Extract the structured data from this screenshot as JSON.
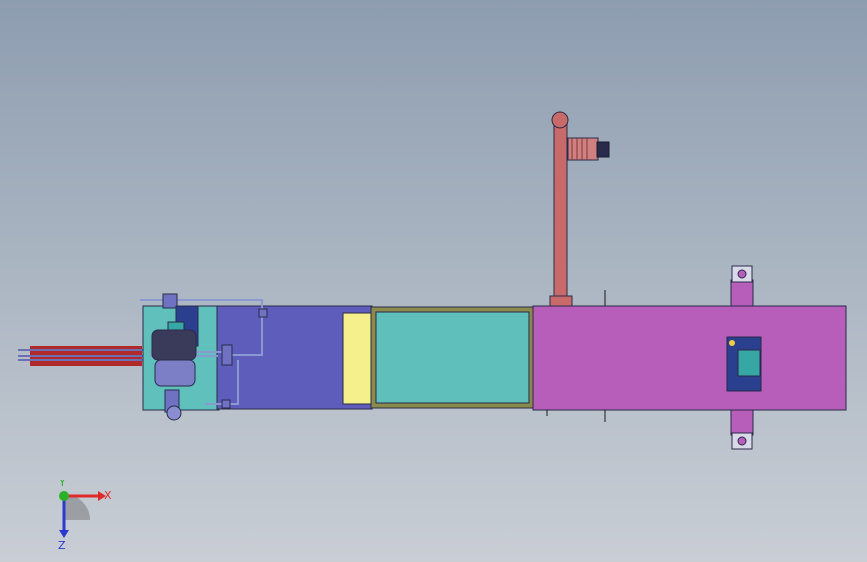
{
  "colors": {
    "cyan_block": "#5fc0bc",
    "blue_block": "#5e5dbb",
    "yellow_block": "#f5f08c",
    "teal_block": "#5fbfba",
    "olive_frame": "#8a8a4a",
    "magenta_block": "#b75dba",
    "salmon_arm": "#c96a6a",
    "red_rod": "#b02a2a",
    "motor_blue": "#2b3f8f",
    "motor_cyan": "#37a7a6",
    "outline": "#2a2a4a"
  },
  "triad": {
    "x_label": "X",
    "y_label": "Y",
    "z_label": "Z",
    "x_color": "#e02a2a",
    "y_color": "#2ab02a",
    "z_color": "#2a3ad0"
  }
}
